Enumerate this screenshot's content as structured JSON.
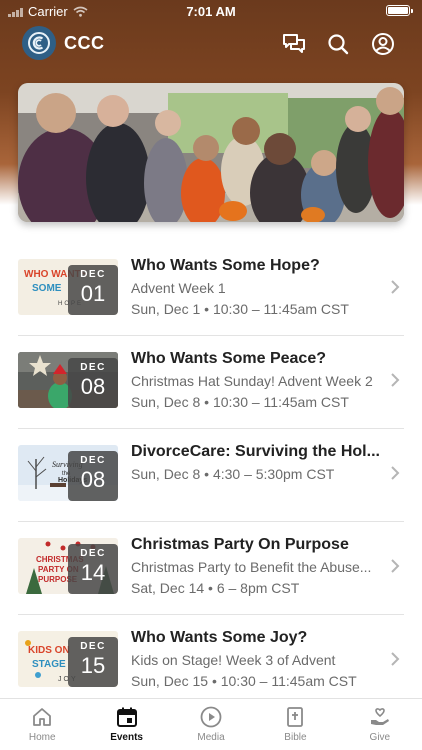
{
  "status_bar": {
    "carrier": "Carrier",
    "time": "7:01 AM"
  },
  "app": {
    "title": "CCC"
  },
  "events": [
    {
      "title": "Who Wants Some Hope?",
      "subtitle": "Advent Week 1",
      "when": "Sun, Dec 1 • 10:30 – 11:45am CST",
      "month": "DEC",
      "day": "01",
      "thumb_text": [
        "WHO WANTS",
        "SOME",
        "HOPE"
      ]
    },
    {
      "title": "Who Wants Some Peace?",
      "subtitle": "Christmas Hat Sunday! Advent Week 2",
      "when": "Sun, Dec 8 • 10:30 – 11:45am CST",
      "month": "DEC",
      "day": "08"
    },
    {
      "title": "DivorceCare: Surviving the Hol...",
      "subtitle": "",
      "when": "Sun, Dec 8 • 4:30 – 5:30pm CST",
      "month": "DEC",
      "day": "08",
      "thumb_text": [
        "Surviving",
        "the",
        "Holidays"
      ]
    },
    {
      "title": "Christmas Party On Purpose",
      "subtitle": "Christmas Party to Benefit the Abuse...",
      "when": "Sat, Dec 14 • 6 – 8pm CST",
      "month": "DEC",
      "day": "14",
      "thumb_text": [
        "CHRISTMAS",
        "PARTY ON",
        "PURPOSE"
      ]
    },
    {
      "title": "Who Wants Some Joy?",
      "subtitle": "Kids on Stage! Week 3 of Advent",
      "when": "Sun, Dec 15 • 10:30 – 11:45am CST",
      "month": "DEC",
      "day": "15",
      "thumb_text": [
        "KIDS ON",
        "STAGE",
        "JOY"
      ]
    }
  ],
  "tabs": [
    {
      "label": "Home",
      "icon": "home-icon"
    },
    {
      "label": "Events",
      "icon": "calendar-icon",
      "active": true
    },
    {
      "label": "Media",
      "icon": "play-icon"
    },
    {
      "label": "Bible",
      "icon": "bible-icon"
    },
    {
      "label": "Give",
      "icon": "give-icon"
    }
  ],
  "colors": {
    "header_brown": "#7d4421",
    "logo_blue": "#2f5f86",
    "active_tab": "#111111",
    "inactive_tab": "#8a8a8a"
  }
}
